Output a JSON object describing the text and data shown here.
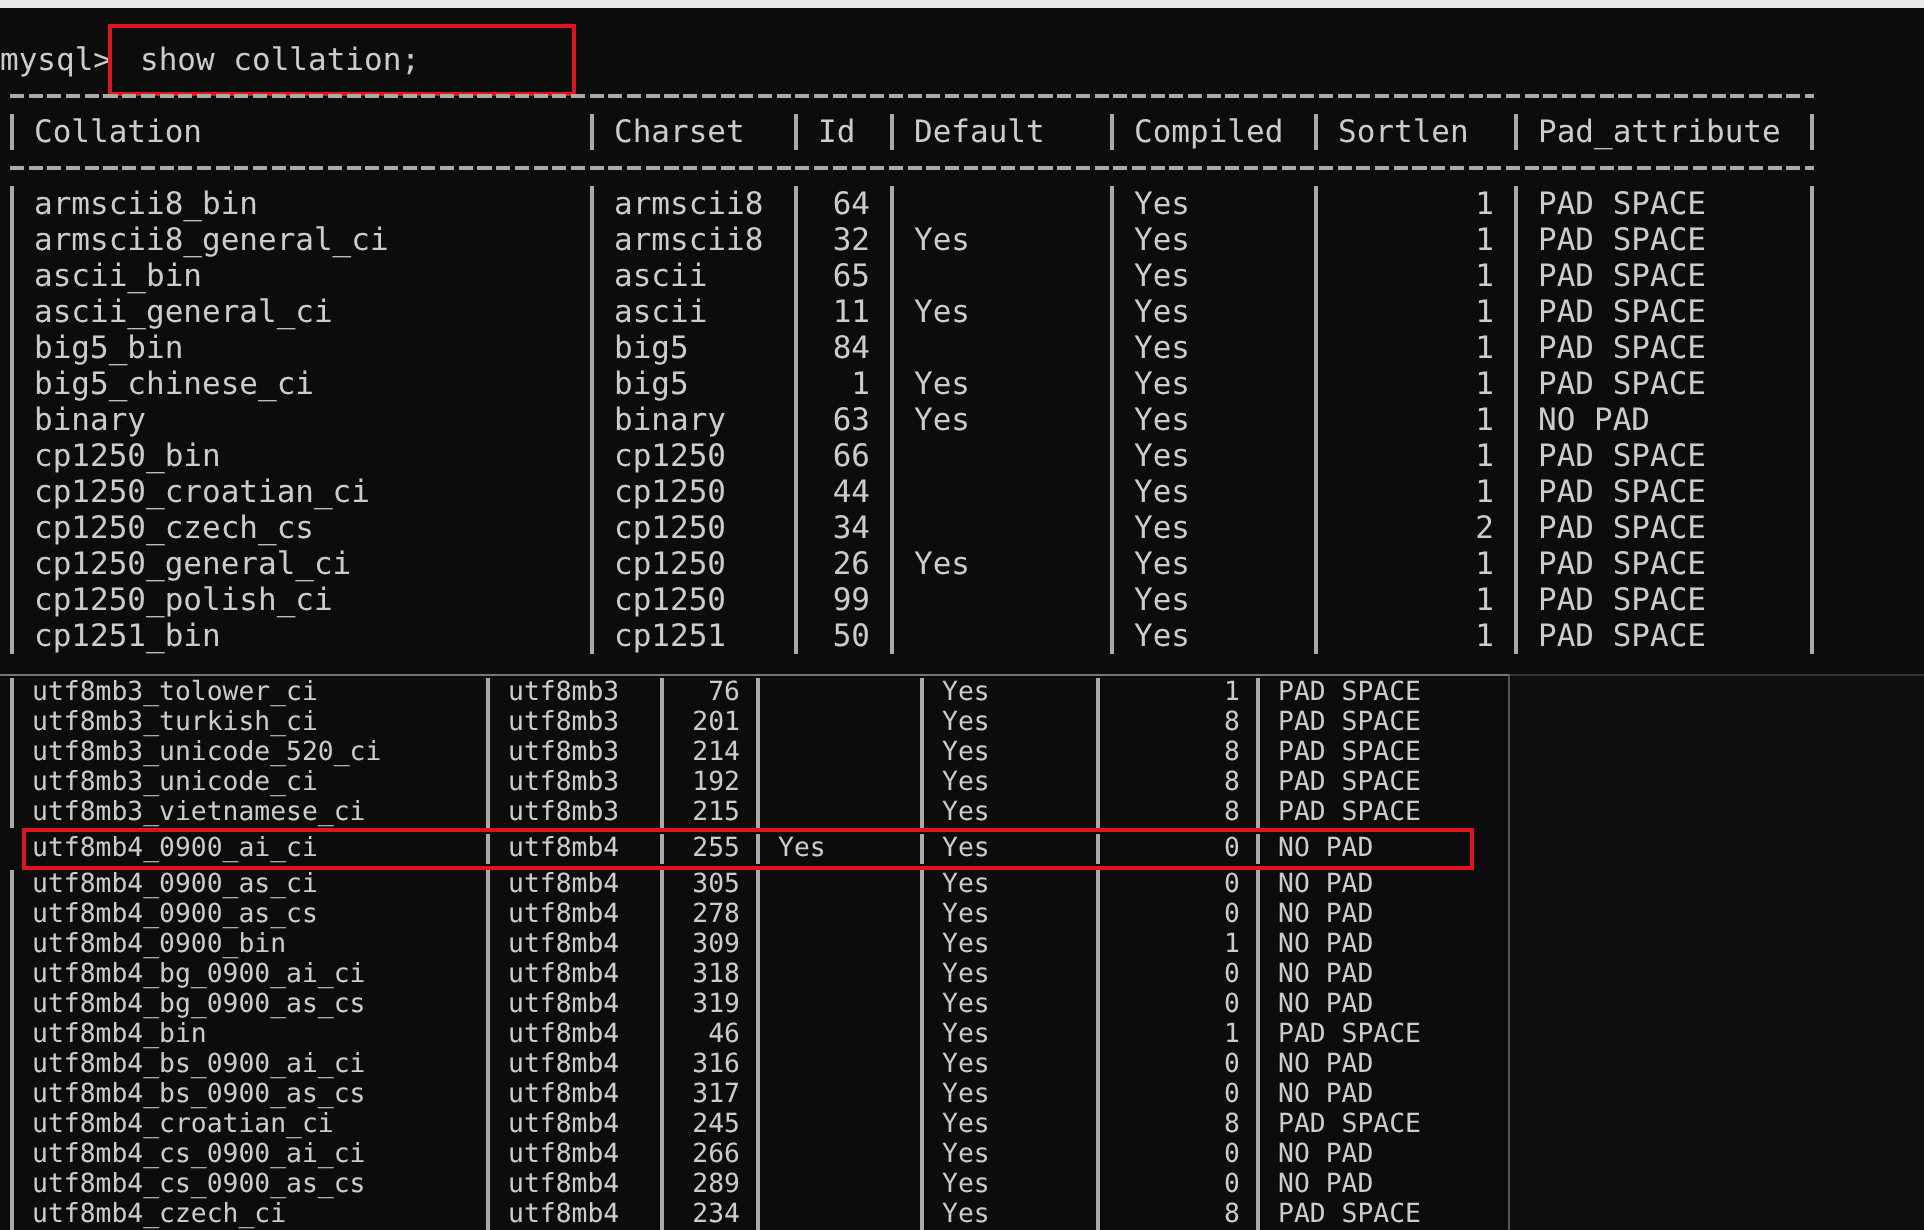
{
  "console": {
    "prompt": "mysql>",
    "command": {
      "text": "show collation;",
      "highlighted": true
    },
    "columns": [
      "Collation",
      "Charset",
      "Id",
      "Default",
      "Compiled",
      "Sortlen",
      "Pad_attribute"
    ],
    "rows": [
      {
        "collation": "armscii8_bin",
        "charset": "armscii8",
        "id": "64",
        "compiled": "Yes",
        "sortlen": "1",
        "pad_attribute": "PAD SPACE"
      },
      {
        "collation": "armscii8_general_ci",
        "charset": "armscii8",
        "id": "32",
        "default": "Yes",
        "compiled": "Yes",
        "sortlen": "1",
        "pad_attribute": "PAD SPACE"
      },
      {
        "collation": "ascii_bin",
        "charset": "ascii",
        "id": "65",
        "compiled": "Yes",
        "sortlen": "1",
        "pad_attribute": "PAD SPACE"
      },
      {
        "collation": "ascii_general_ci",
        "charset": "ascii",
        "id": "11",
        "default": "Yes",
        "compiled": "Yes",
        "sortlen": "1",
        "pad_attribute": "PAD SPACE"
      },
      {
        "collation": "big5_bin",
        "charset": "big5",
        "id": "84",
        "compiled": "Yes",
        "sortlen": "1",
        "pad_attribute": "PAD SPACE"
      },
      {
        "collation": "big5_chinese_ci",
        "charset": "big5",
        "id": "1",
        "default": "Yes",
        "compiled": "Yes",
        "sortlen": "1",
        "pad_attribute": "PAD SPACE"
      },
      {
        "collation": "binary",
        "charset": "binary",
        "id": "63",
        "default": "Yes",
        "compiled": "Yes",
        "sortlen": "1",
        "pad_attribute": "NO PAD"
      },
      {
        "collation": "cp1250_bin",
        "charset": "cp1250",
        "id": "66",
        "compiled": "Yes",
        "sortlen": "1",
        "pad_attribute": "PAD SPACE"
      },
      {
        "collation": "cp1250_croatian_ci",
        "charset": "cp1250",
        "id": "44",
        "compiled": "Yes",
        "sortlen": "1",
        "pad_attribute": "PAD SPACE"
      },
      {
        "collation": "cp1250_czech_cs",
        "charset": "cp1250",
        "id": "34",
        "compiled": "Yes",
        "sortlen": "2",
        "pad_attribute": "PAD SPACE"
      },
      {
        "collation": "cp1250_general_ci",
        "charset": "cp1250",
        "id": "26",
        "default": "Yes",
        "compiled": "Yes",
        "sortlen": "1",
        "pad_attribute": "PAD SPACE"
      },
      {
        "collation": "cp1250_polish_ci",
        "charset": "cp1250",
        "id": "99",
        "compiled": "Yes",
        "sortlen": "1",
        "pad_attribute": "PAD SPACE"
      },
      {
        "collation": "cp1251_bin",
        "charset": "cp1251",
        "id": "50",
        "compiled": "Yes",
        "sortlen": "1",
        "pad_attribute": "PAD SPACE"
      }
    ]
  },
  "overlay_console": {
    "rows": [
      {
        "collation": "utf8mb3_tolower_ci",
        "charset": "utf8mb3",
        "id": "76",
        "compiled": "Yes",
        "sortlen": "1",
        "pad_attribute": "PAD SPACE",
        "highlighted": false
      },
      {
        "collation": "utf8mb3_turkish_ci",
        "charset": "utf8mb3",
        "id": "201",
        "compiled": "Yes",
        "sortlen": "8",
        "pad_attribute": "PAD SPACE",
        "highlighted": false
      },
      {
        "collation": "utf8mb3_unicode_520_ci",
        "charset": "utf8mb3",
        "id": "214",
        "compiled": "Yes",
        "sortlen": "8",
        "pad_attribute": "PAD SPACE",
        "highlighted": false
      },
      {
        "collation": "utf8mb3_unicode_ci",
        "charset": "utf8mb3",
        "id": "192",
        "compiled": "Yes",
        "sortlen": "8",
        "pad_attribute": "PAD SPACE",
        "highlighted": false
      },
      {
        "collation": "utf8mb3_vietnamese_ci",
        "charset": "utf8mb3",
        "id": "215",
        "compiled": "Yes",
        "sortlen": "8",
        "pad_attribute": "PAD SPACE",
        "highlighted": false
      },
      {
        "collation": "utf8mb4_0900_ai_ci",
        "charset": "utf8mb4",
        "id": "255",
        "default": "Yes",
        "compiled": "Yes",
        "sortlen": "0",
        "pad_attribute": "NO PAD",
        "highlighted": true
      },
      {
        "collation": "utf8mb4_0900_as_ci",
        "charset": "utf8mb4",
        "id": "305",
        "compiled": "Yes",
        "sortlen": "0",
        "pad_attribute": "NO PAD",
        "highlighted": false
      },
      {
        "collation": "utf8mb4_0900_as_cs",
        "charset": "utf8mb4",
        "id": "278",
        "compiled": "Yes",
        "sortlen": "0",
        "pad_attribute": "NO PAD",
        "highlighted": false
      },
      {
        "collation": "utf8mb4_0900_bin",
        "charset": "utf8mb4",
        "id": "309",
        "compiled": "Yes",
        "sortlen": "1",
        "pad_attribute": "NO PAD",
        "highlighted": false
      },
      {
        "collation": "utf8mb4_bg_0900_ai_ci",
        "charset": "utf8mb4",
        "id": "318",
        "compiled": "Yes",
        "sortlen": "0",
        "pad_attribute": "NO PAD",
        "highlighted": false
      },
      {
        "collation": "utf8mb4_bg_0900_as_cs",
        "charset": "utf8mb4",
        "id": "319",
        "compiled": "Yes",
        "sortlen": "0",
        "pad_attribute": "NO PAD",
        "highlighted": false
      },
      {
        "collation": "utf8mb4_bin",
        "charset": "utf8mb4",
        "id": "46",
        "compiled": "Yes",
        "sortlen": "1",
        "pad_attribute": "PAD SPACE",
        "highlighted": false
      },
      {
        "collation": "utf8mb4_bs_0900_ai_ci",
        "charset": "utf8mb4",
        "id": "316",
        "compiled": "Yes",
        "sortlen": "0",
        "pad_attribute": "NO PAD",
        "highlighted": false
      },
      {
        "collation": "utf8mb4_bs_0900_as_cs",
        "charset": "utf8mb4",
        "id": "317",
        "compiled": "Yes",
        "sortlen": "0",
        "pad_attribute": "NO PAD",
        "highlighted": false
      },
      {
        "collation": "utf8mb4_croatian_ci",
        "charset": "utf8mb4",
        "id": "245",
        "compiled": "Yes",
        "sortlen": "8",
        "pad_attribute": "PAD SPACE",
        "highlighted": false
      },
      {
        "collation": "utf8mb4_cs_0900_ai_ci",
        "charset": "utf8mb4",
        "id": "266",
        "compiled": "Yes",
        "sortlen": "0",
        "pad_attribute": "NO PAD",
        "highlighted": false
      },
      {
        "collation": "utf8mb4_cs_0900_as_cs",
        "charset": "utf8mb4",
        "id": "289",
        "compiled": "Yes",
        "sortlen": "0",
        "pad_attribute": "NO PAD",
        "highlighted": false
      },
      {
        "collation": "utf8mb4_czech_ci",
        "charset": "utf8mb4",
        "id": "234",
        "compiled": "Yes",
        "sortlen": "8",
        "pad_attribute": "PAD SPACE",
        "highlighted": false
      }
    ]
  }
}
